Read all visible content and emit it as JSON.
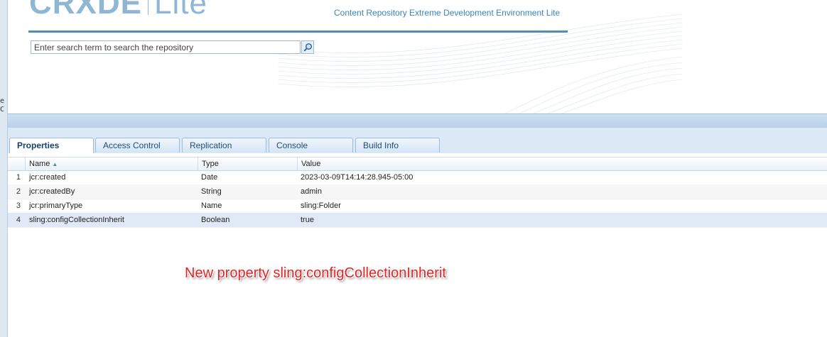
{
  "left_strip": {
    "glyphs": [
      "e",
      "C"
    ]
  },
  "header": {
    "logo_main": "CRXDE",
    "logo_sub": "Lite",
    "tagline": "Content Repository Extreme Development Environment Lite",
    "search_placeholder": "Enter search term to search the repository",
    "search_icon": "magnifier-icon"
  },
  "tabs": [
    {
      "label": "Properties",
      "active": true
    },
    {
      "label": "Access Control",
      "active": false
    },
    {
      "label": "Replication",
      "active": false
    },
    {
      "label": "Console",
      "active": false
    },
    {
      "label": "Build Info",
      "active": false
    }
  ],
  "table": {
    "columns": [
      "Name",
      "Type",
      "Value"
    ],
    "sort_indicator": "▲",
    "rows": [
      {
        "num": "1",
        "name": "jcr:created",
        "type": "Date",
        "value": "2023-03-09T14:14:28.945-05:00"
      },
      {
        "num": "2",
        "name": "jcr:createdBy",
        "type": "String",
        "value": "admin"
      },
      {
        "num": "3",
        "name": "jcr:primaryType",
        "type": "Name",
        "value": "sling:Folder"
      },
      {
        "num": "4",
        "name": "sling:configCollectionInherit",
        "type": "Boolean",
        "value": "true",
        "selected": true
      }
    ]
  },
  "annotation": "New property sling:configCollectionInherit",
  "colors": {
    "accent": "#4e8fb3",
    "tab_text": "#1f4b77",
    "annotation": "#e52222",
    "selected_row": "#dfeaf6"
  }
}
